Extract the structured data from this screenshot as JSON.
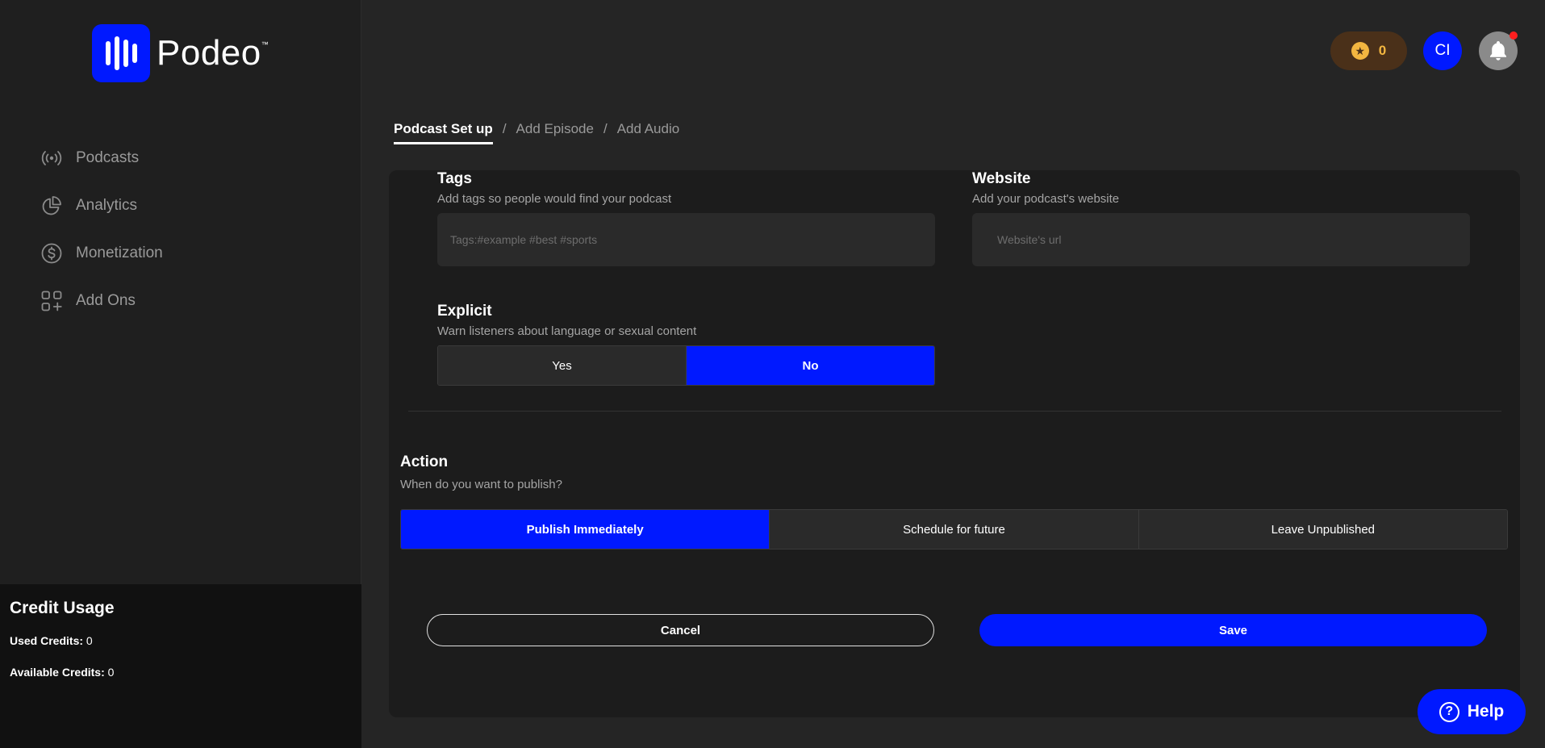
{
  "brand": {
    "name": "Podeo",
    "trademark": "™",
    "accent": "#0019ff"
  },
  "sidebar": {
    "items": [
      {
        "label": "Podcasts",
        "icon": "broadcast-icon"
      },
      {
        "label": "Analytics",
        "icon": "pie-chart-icon"
      },
      {
        "label": "Monetization",
        "icon": "dollar-circle-icon"
      },
      {
        "label": "Add Ons",
        "icon": "grid-plus-icon"
      }
    ],
    "credit_usage": {
      "title": "Credit Usage",
      "used_label": "Used Credits:",
      "used_value": "0",
      "available_label": "Available Credits:",
      "available_value": "0"
    }
  },
  "topbar": {
    "coins": "0",
    "avatar_initials": "CI"
  },
  "breadcrumb": {
    "step1": "Podcast Set up",
    "step2": "Add Episode",
    "step3": "Add Audio",
    "separator": "/"
  },
  "form": {
    "tags": {
      "title": "Tags",
      "subtitle": "Add tags so people would find your podcast",
      "placeholder": "Tags:#example #best #sports",
      "value": ""
    },
    "website": {
      "title": "Website",
      "subtitle": "Add your podcast's website",
      "placeholder": "Website's url",
      "value": ""
    },
    "explicit": {
      "title": "Explicit",
      "subtitle": "Warn listeners about language or sexual content",
      "options": [
        "Yes",
        "No"
      ],
      "selected": "No"
    },
    "action": {
      "title": "Action",
      "subtitle": "When do you want to publish?",
      "options": [
        "Publish Immediately",
        "Schedule for future",
        "Leave Unpublished"
      ],
      "selected": "Publish Immediately"
    },
    "cancel_label": "Cancel",
    "save_label": "Save"
  },
  "help": {
    "label": "Help"
  }
}
